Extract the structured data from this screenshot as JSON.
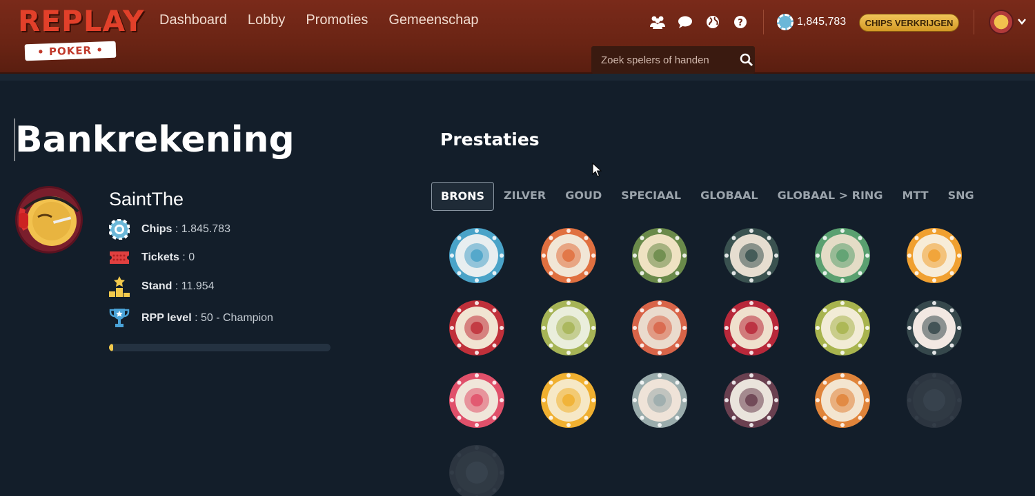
{
  "header": {
    "logo_top": "REPLAY",
    "logo_bottom": "POKER",
    "nav": [
      "Dashboard",
      "Lobby",
      "Promoties",
      "Gemeenschap"
    ],
    "icons": [
      "friends-icon",
      "chat-icon",
      "globe-icon",
      "help-icon"
    ],
    "chip_balance": "1,845,783",
    "buy_chips_label": "CHIPS VERKRIJGEN",
    "search_placeholder": "Zoek spelers of handen"
  },
  "account": {
    "title": "Bankrekening",
    "username": "SaintThe",
    "stats": [
      {
        "label": "Chips",
        "value": "1.845.783",
        "icon": "chip-icon"
      },
      {
        "label": "Tickets",
        "value": "0",
        "icon": "ticket-icon"
      },
      {
        "label": "Stand",
        "value": "11.954",
        "icon": "podium-icon"
      },
      {
        "label": "RPP level",
        "value": "50 - Champion",
        "icon": "trophy-icon"
      }
    ],
    "level_progress": 0.02
  },
  "achievements": {
    "title": "Prestaties",
    "tabs": [
      "BRONS",
      "ZILVER",
      "GOUD",
      "SPECIAAL",
      "GLOBAAL",
      "GLOBAAL > RING",
      "MTT",
      "SNG"
    ],
    "active_tab": "BRONS",
    "badges": [
      {
        "name": "pacifier-badge",
        "ring": "#4aa3c8",
        "face": "#e8eef0",
        "earned": true
      },
      {
        "name": "diamond-card-badge",
        "ring": "#e07040",
        "face": "#f1e6d6",
        "earned": true
      },
      {
        "name": "flexing-arm-badge",
        "ring": "#6a8a4a",
        "face": "#efe2c2",
        "earned": true
      },
      {
        "name": "crowd-badge",
        "ring": "#3a5250",
        "face": "#e6ddd0",
        "earned": true
      },
      {
        "name": "target-badge",
        "ring": "#5aa070",
        "face": "#e4dcc6",
        "earned": true
      },
      {
        "name": "flame-badge",
        "ring": "#f0a030",
        "face": "#f7ecd8",
        "earned": true
      },
      {
        "name": "insert-coin-badge",
        "ring": "#c0303a",
        "face": "#f1e4d2",
        "earned": true
      },
      {
        "name": "clover-badge",
        "ring": "#a6b456",
        "face": "#eaeedc",
        "earned": true
      },
      {
        "name": "gun-badge",
        "ring": "#d86448",
        "face": "#eadbcd",
        "earned": true
      },
      {
        "name": "royals-badge",
        "ring": "#b8283a",
        "face": "#efe0cd",
        "earned": true
      },
      {
        "name": "pot-of-gold-badge",
        "ring": "#a8b44e",
        "face": "#f2ecd6",
        "earned": true
      },
      {
        "name": "dynamite-badge",
        "ring": "#36484c",
        "face": "#f2e8e2",
        "earned": true
      },
      {
        "name": "magic-hat-badge",
        "ring": "#e0506a",
        "face": "#f0e6da",
        "earned": true
      },
      {
        "name": "gold-bars-badge",
        "ring": "#f0b030",
        "face": "#f6e8c6",
        "earned": true
      },
      {
        "name": "bowling-badge",
        "ring": "#9aacac",
        "face": "#efe3d8",
        "earned": true
      },
      {
        "name": "crystal-ball-badge",
        "ring": "#6a4050",
        "face": "#eae4dc",
        "earned": true
      },
      {
        "name": "devil-badge",
        "ring": "#e0843a",
        "face": "#f3e5d0",
        "earned": true
      },
      {
        "name": "cake-badge",
        "ring": "#2c3540",
        "face": "#303a44",
        "earned": false
      },
      {
        "name": "cards-hand-badge",
        "ring": "#2c3540",
        "face": "#303a44",
        "earned": false
      }
    ]
  }
}
